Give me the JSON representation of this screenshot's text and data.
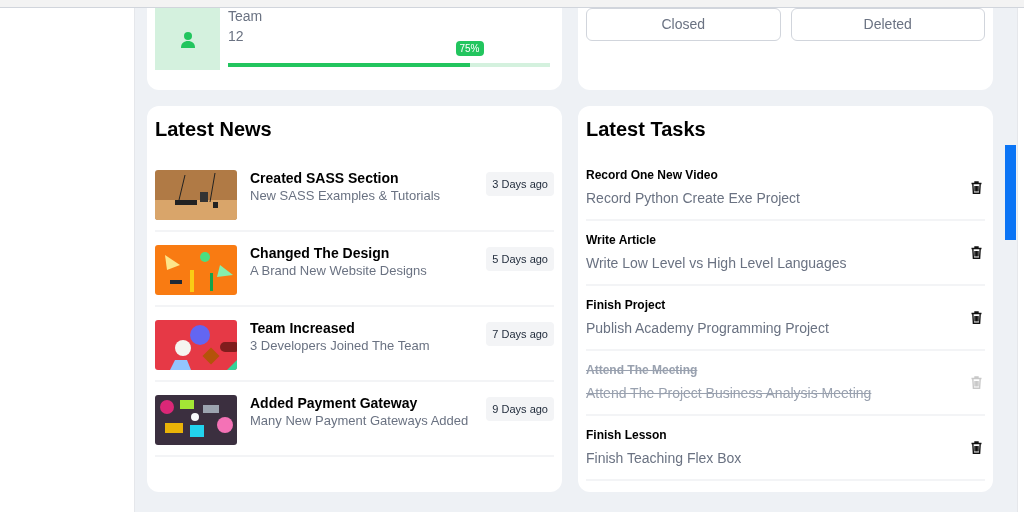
{
  "stats_card": {
    "label": "Team",
    "value": "12",
    "level": 0.75,
    "tooltip": "75%"
  },
  "status_buttons": [
    "Closed",
    "Deleted"
  ],
  "latest_news": {
    "title": "Latest News",
    "items": [
      {
        "title": "Created SASS Section",
        "subtitle": "New SASS Examples & Tutorials",
        "time": "3 Days ago",
        "kind": "picture"
      },
      {
        "title": "Changed The Design",
        "subtitle": "A Brand New Website Designs",
        "time": "5 Days ago",
        "kind": "picture"
      },
      {
        "title": "Team Increased",
        "subtitle": "3 Developers Joined The Team",
        "time": "7 Days ago",
        "kind": "picture"
      },
      {
        "title": "Added Payment Gateway",
        "subtitle": "Many New Payment Gateways Added",
        "time": "9 Days ago",
        "kind": "picture"
      }
    ]
  },
  "latest_tasks": {
    "title": "Latest Tasks",
    "items": [
      {
        "title": "Record One New Video",
        "description": "Record Python Create Exe Project",
        "done": false
      },
      {
        "title": "Write Article",
        "description": "Write Low Level vs High Level Languages",
        "done": false
      },
      {
        "title": "Finish Project",
        "description": "Publish Academy Programming Project",
        "done": false
      },
      {
        "title": "Attend The Meeting",
        "description": "Attend The Project Business Analysis Meeting",
        "done": true
      },
      {
        "title": "Finish Lesson",
        "description": "Finish Teaching Flex Box",
        "done": false
      }
    ]
  }
}
